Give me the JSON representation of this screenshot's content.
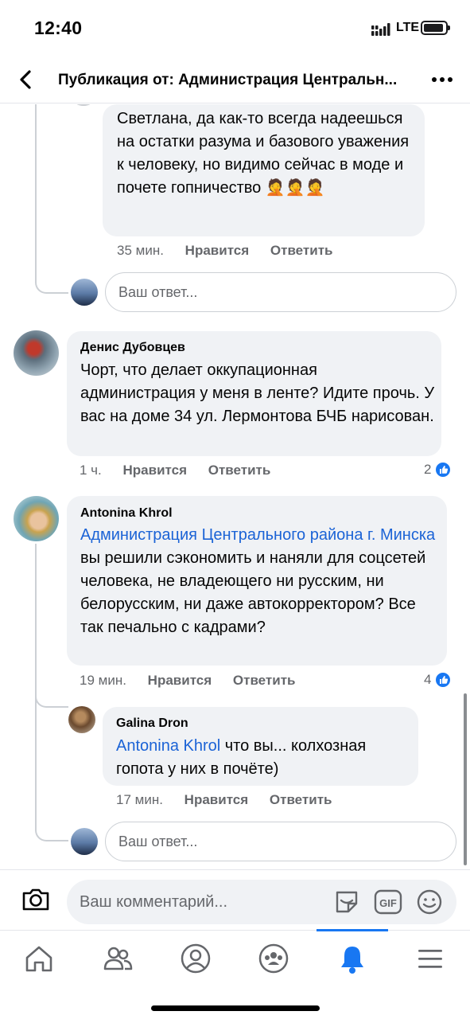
{
  "status_bar": {
    "time": "12:40",
    "network": "LTE"
  },
  "header": {
    "title": "Публикация от: Администрация Центральн..."
  },
  "comments": [
    {
      "text": "Светлана, да как-то всегда надеешься на остатки разума и базового уважения к человеку, но видимо сейчас в моде и почете гопничество 🤦🤦🤦",
      "time": "35 мин.",
      "like_label": "Нравится",
      "reply_label": "Ответить"
    },
    {
      "author": "Денис Дубовцев",
      "text": "Чорт, что делает оккупационная администрация у меня в ленте? Идите прочь. У вас на доме 34 ул. Лермонтова БЧБ нарисован.",
      "time": "1 ч.",
      "like_label": "Нравится",
      "reply_label": "Ответить",
      "reactions": "2"
    },
    {
      "author": "Antonina Khrol",
      "mention": "Администрация Центрального района г. Минска",
      "text": " вы решили сэкономить и наняли для соцсетей человека, не владеющего ни русским, ни белорусским, ни даже автокорректором? Все так печально с кадрами?",
      "time": "19 мин.",
      "like_label": "Нравится",
      "reply_label": "Ответить",
      "reactions": "4"
    },
    {
      "author": "Galina Dron",
      "mention": "Antonina Khrol",
      "text": " что вы... колхозная гопота у них в почёте)",
      "time": "17 мин.",
      "like_label": "Нравится",
      "reply_label": "Ответить"
    }
  ],
  "reply_placeholder": "Ваш ответ...",
  "composer": {
    "placeholder": "Ваш комментарий..."
  },
  "nav": {
    "items": [
      "home-icon",
      "friends-icon",
      "profile-icon",
      "groups-icon",
      "notifications-icon",
      "menu-icon"
    ],
    "active": "notifications-icon"
  },
  "colors": {
    "accent": "#1877f2",
    "link": "#1b63d6",
    "bubble": "#f0f2f5",
    "muted": "#65676b"
  }
}
